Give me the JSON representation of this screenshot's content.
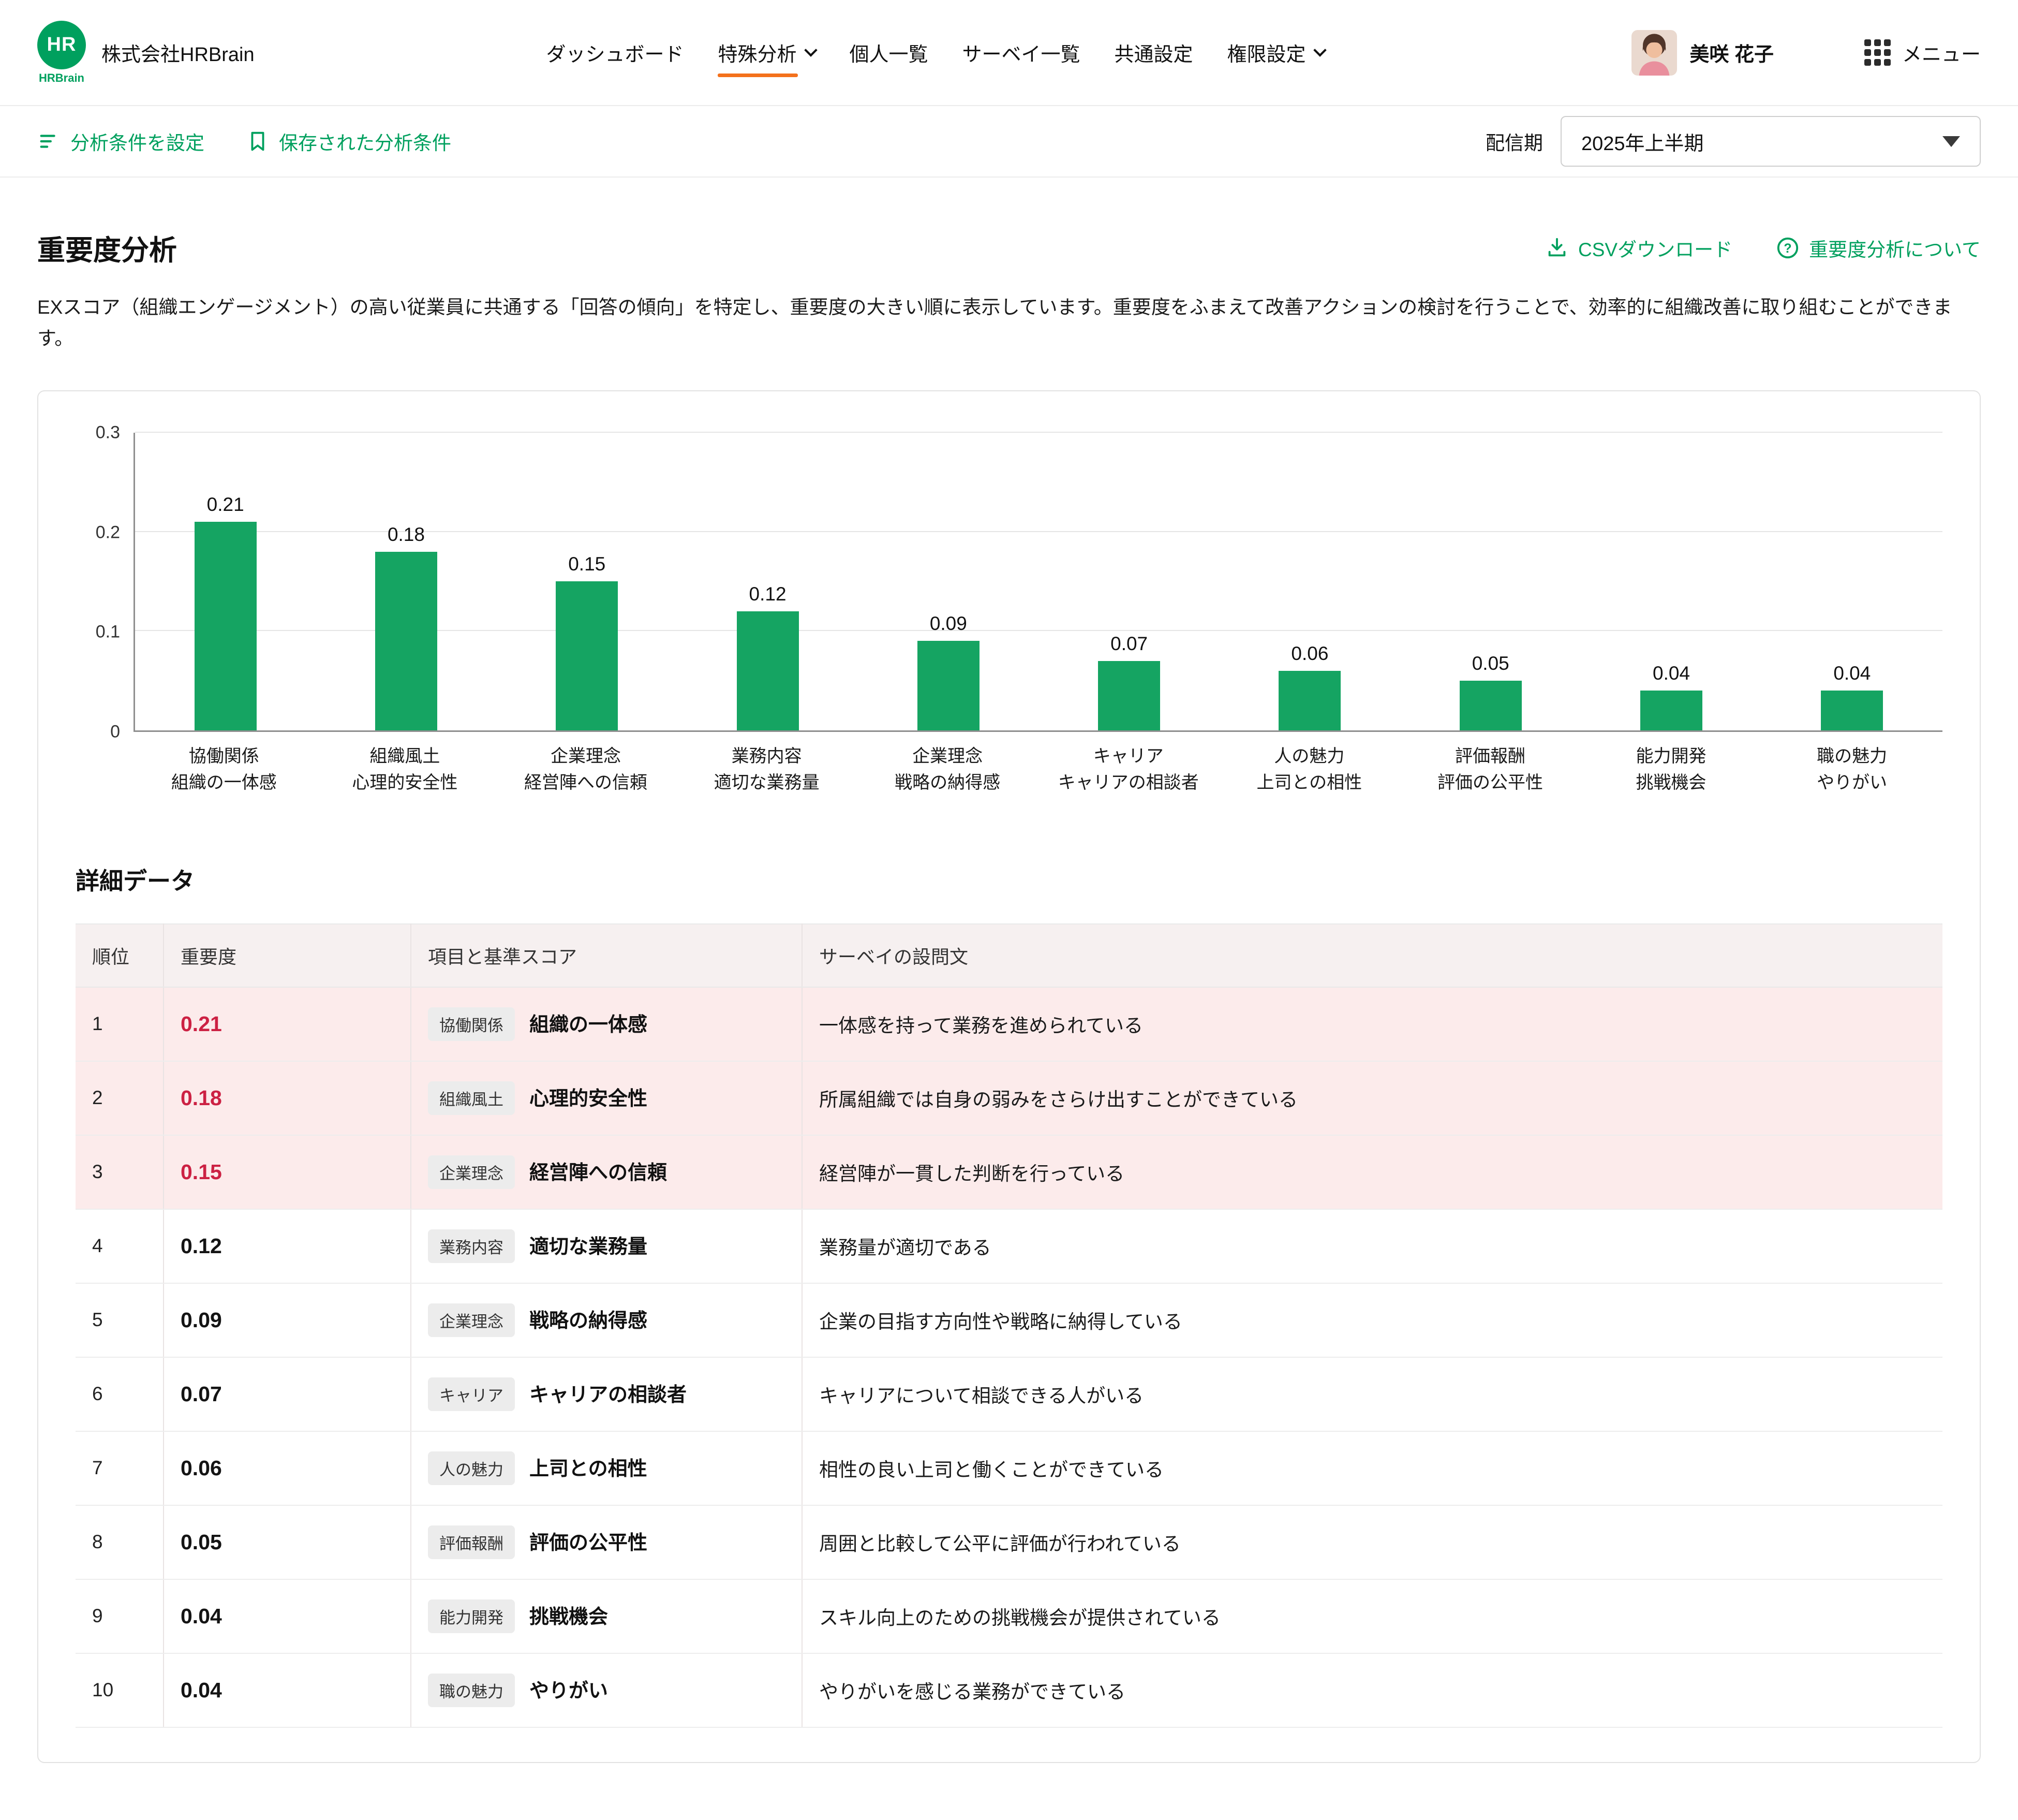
{
  "colors": {
    "brand_green": "#00a05e",
    "active_tab_orange": "#f4711c",
    "importance_red": "#cc2143",
    "highlight_row_pink": "#fcebeb",
    "bar_green": "#15a462"
  },
  "header": {
    "logo_text": "HR",
    "logo_subtext": "HRBrain",
    "company_name": "株式会社HRBrain",
    "nav": [
      {
        "name": "dashboard",
        "label": "ダッシュボード",
        "active": false,
        "chevron": false
      },
      {
        "name": "special-analysis",
        "label": "特殊分析",
        "active": true,
        "chevron": true
      },
      {
        "name": "individual-list",
        "label": "個人一覧",
        "active": false,
        "chevron": false
      },
      {
        "name": "survey-list",
        "label": "サーベイ一覧",
        "active": false,
        "chevron": false
      },
      {
        "name": "common-settings",
        "label": "共通設定",
        "active": false,
        "chevron": false
      },
      {
        "name": "permission-settings",
        "label": "権限設定",
        "active": false,
        "chevron": true
      }
    ],
    "user_name": "美咲 花子",
    "menu_label": "メニュー"
  },
  "toolbar": {
    "set_conditions_label": "分析条件を設定",
    "saved_conditions_label": "保存された分析条件",
    "period_label": "配信期",
    "period_value": "2025年上半期"
  },
  "page": {
    "title": "重要度分析",
    "csv_download_label": "CSVダウンロード",
    "about_label": "重要度分析について",
    "description": "EXスコア（組織エンゲージメント）の高い従業員に共通する「回答の傾向」を特定し、重要度の大きい順に表示しています。重要度をふまえて改善アクションの検討を行うことで、効率的に組織改善に取り組むことができます。"
  },
  "chart_data": {
    "type": "bar",
    "title": "",
    "xlabel": "",
    "ylabel": "",
    "categories": [
      [
        "協働関係",
        "組織の一体感"
      ],
      [
        "組織風土",
        "心理的安全性"
      ],
      [
        "企業理念",
        "経営陣への信頼"
      ],
      [
        "業務内容",
        "適切な業務量"
      ],
      [
        "企業理念",
        "戦略の納得感"
      ],
      [
        "キャリア",
        "キャリアの相談者"
      ],
      [
        "人の魅力",
        "上司との相性"
      ],
      [
        "評価報酬",
        "評価の公平性"
      ],
      [
        "能力開発",
        "挑戦機会"
      ],
      [
        "職の魅力",
        "やりがい"
      ]
    ],
    "values": [
      0.21,
      0.18,
      0.15,
      0.12,
      0.09,
      0.07,
      0.06,
      0.05,
      0.04,
      0.04
    ],
    "ylim": [
      0,
      0.3
    ],
    "yticks": [
      0,
      0.1,
      0.2,
      0.3
    ],
    "grid": true,
    "legend": false,
    "bar_color": "#15a462"
  },
  "detail": {
    "title": "詳細データ",
    "columns": [
      "順位",
      "重要度",
      "項目と基準スコア",
      "サーベイの設問文"
    ],
    "rows": [
      {
        "rank": "1",
        "importance": "0.21",
        "category": "協働関係",
        "item": "組織の一体感",
        "question": "一体感を持って業務を進められている",
        "highlight": true
      },
      {
        "rank": "2",
        "importance": "0.18",
        "category": "組織風土",
        "item": "心理的安全性",
        "question": "所属組織では自身の弱みをさらけ出すことができている",
        "highlight": true
      },
      {
        "rank": "3",
        "importance": "0.15",
        "category": "企業理念",
        "item": "経営陣への信頼",
        "question": "経営陣が一貫した判断を行っている",
        "highlight": true
      },
      {
        "rank": "4",
        "importance": "0.12",
        "category": "業務内容",
        "item": "適切な業務量",
        "question": "業務量が適切である",
        "highlight": false
      },
      {
        "rank": "5",
        "importance": "0.09",
        "category": "企業理念",
        "item": "戦略の納得感",
        "question": "企業の目指す方向性や戦略に納得している",
        "highlight": false
      },
      {
        "rank": "6",
        "importance": "0.07",
        "category": "キャリア",
        "item": "キャリアの相談者",
        "question": "キャリアについて相談できる人がいる",
        "highlight": false
      },
      {
        "rank": "7",
        "importance": "0.06",
        "category": "人の魅力",
        "item": "上司との相性",
        "question": "相性の良い上司と働くことができている",
        "highlight": false
      },
      {
        "rank": "8",
        "importance": "0.05",
        "category": "評価報酬",
        "item": "評価の公平性",
        "question": "周囲と比較して公平に評価が行われている",
        "highlight": false
      },
      {
        "rank": "9",
        "importance": "0.04",
        "category": "能力開発",
        "item": "挑戦機会",
        "question": "スキル向上のための挑戦機会が提供されている",
        "highlight": false
      },
      {
        "rank": "10",
        "importance": "0.04",
        "category": "職の魅力",
        "item": "やりがい",
        "question": "やりがいを感じる業務ができている",
        "highlight": false
      }
    ]
  }
}
